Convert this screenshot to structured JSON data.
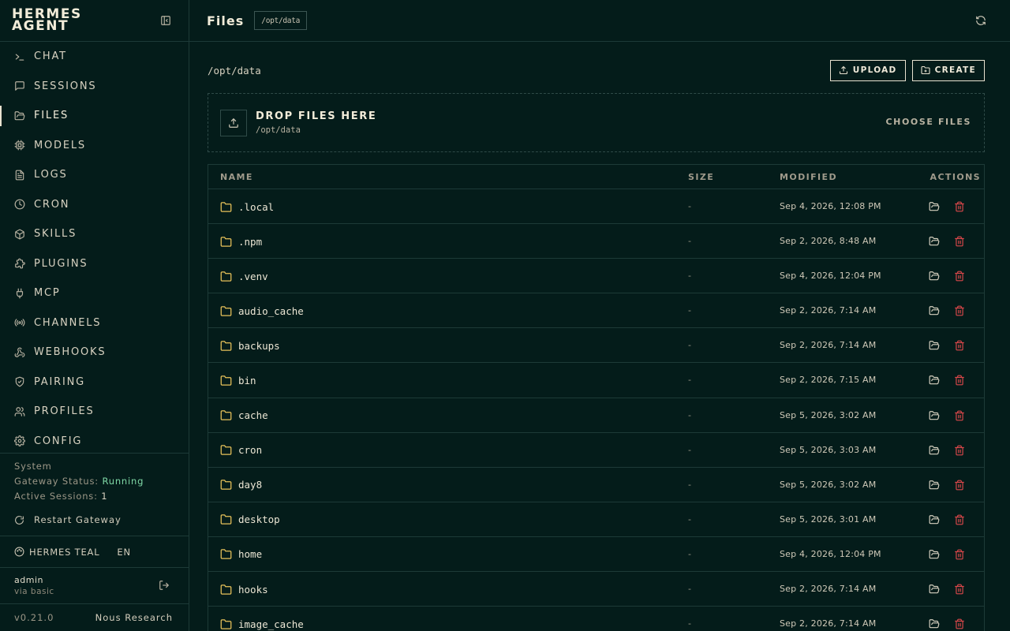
{
  "brand": {
    "line1": "HERMES",
    "line2": "AGENT"
  },
  "nav": [
    {
      "label": "CHAT",
      "icon": "terminal-icon"
    },
    {
      "label": "SESSIONS",
      "icon": "message-square-icon"
    },
    {
      "label": "FILES",
      "icon": "folder-open-icon",
      "active": true
    },
    {
      "label": "MODELS",
      "icon": "cpu-icon"
    },
    {
      "label": "LOGS",
      "icon": "file-text-icon"
    },
    {
      "label": "CRON",
      "icon": "clock-icon"
    },
    {
      "label": "SKILLS",
      "icon": "package-icon"
    },
    {
      "label": "PLUGINS",
      "icon": "puzzle-icon"
    },
    {
      "label": "MCP",
      "icon": "plug-icon"
    },
    {
      "label": "CHANNELS",
      "icon": "radio-icon"
    },
    {
      "label": "WEBHOOKS",
      "icon": "webhook-icon"
    },
    {
      "label": "PAIRING",
      "icon": "shield-check-icon"
    },
    {
      "label": "PROFILES",
      "icon": "users-icon"
    },
    {
      "label": "CONFIG",
      "icon": "settings-icon"
    }
  ],
  "system": {
    "heading": "System",
    "gateway_label": "Gateway Status:",
    "gateway_value": "Running",
    "sessions_label": "Active Sessions:",
    "sessions_value": "1",
    "restart_label": "Restart Gateway"
  },
  "theme": {
    "name": "HERMES TEAL",
    "lang": "EN"
  },
  "user": {
    "name": "admin",
    "via": "via basic"
  },
  "footer": {
    "version": "v0.21.0",
    "org": "Nous Research"
  },
  "header": {
    "title": "Files",
    "path_chip": "/opt/data"
  },
  "toolbar": {
    "current_path": "/opt/data",
    "upload_label": "UPLOAD",
    "create_label": "CREATE"
  },
  "dropzone": {
    "title": "DROP FILES HERE",
    "subtitle": "/opt/data",
    "choose_label": "CHOOSE FILES"
  },
  "table": {
    "headers": {
      "name": "NAME",
      "size": "SIZE",
      "modified": "MODIFIED",
      "actions": "ACTIONS"
    },
    "rows": [
      {
        "name": ".local",
        "size": "-",
        "modified": "Sep 4, 2026, 12:08 PM"
      },
      {
        "name": ".npm",
        "size": "-",
        "modified": "Sep 2, 2026, 8:48 AM"
      },
      {
        "name": ".venv",
        "size": "-",
        "modified": "Sep 4, 2026, 12:04 PM"
      },
      {
        "name": "audio_cache",
        "size": "-",
        "modified": "Sep 2, 2026, 7:14 AM"
      },
      {
        "name": "backups",
        "size": "-",
        "modified": "Sep 2, 2026, 7:14 AM"
      },
      {
        "name": "bin",
        "size": "-",
        "modified": "Sep 2, 2026, 7:15 AM"
      },
      {
        "name": "cache",
        "size": "-",
        "modified": "Sep 5, 2026, 3:02 AM"
      },
      {
        "name": "cron",
        "size": "-",
        "modified": "Sep 5, 2026, 3:03 AM"
      },
      {
        "name": "day8",
        "size": "-",
        "modified": "Sep 5, 2026, 3:02 AM"
      },
      {
        "name": "desktop",
        "size": "-",
        "modified": "Sep 5, 2026, 3:01 AM"
      },
      {
        "name": "home",
        "size": "-",
        "modified": "Sep 4, 2026, 12:04 PM"
      },
      {
        "name": "hooks",
        "size": "-",
        "modified": "Sep 2, 2026, 7:14 AM"
      },
      {
        "name": "image_cache",
        "size": "-",
        "modified": "Sep 2, 2026, 7:14 AM"
      }
    ]
  },
  "colors": {
    "background": "#041c1a",
    "border": "#1d3a37",
    "folder": "#e8c25a",
    "danger": "#d9474a",
    "ok": "#7fd8a6"
  }
}
